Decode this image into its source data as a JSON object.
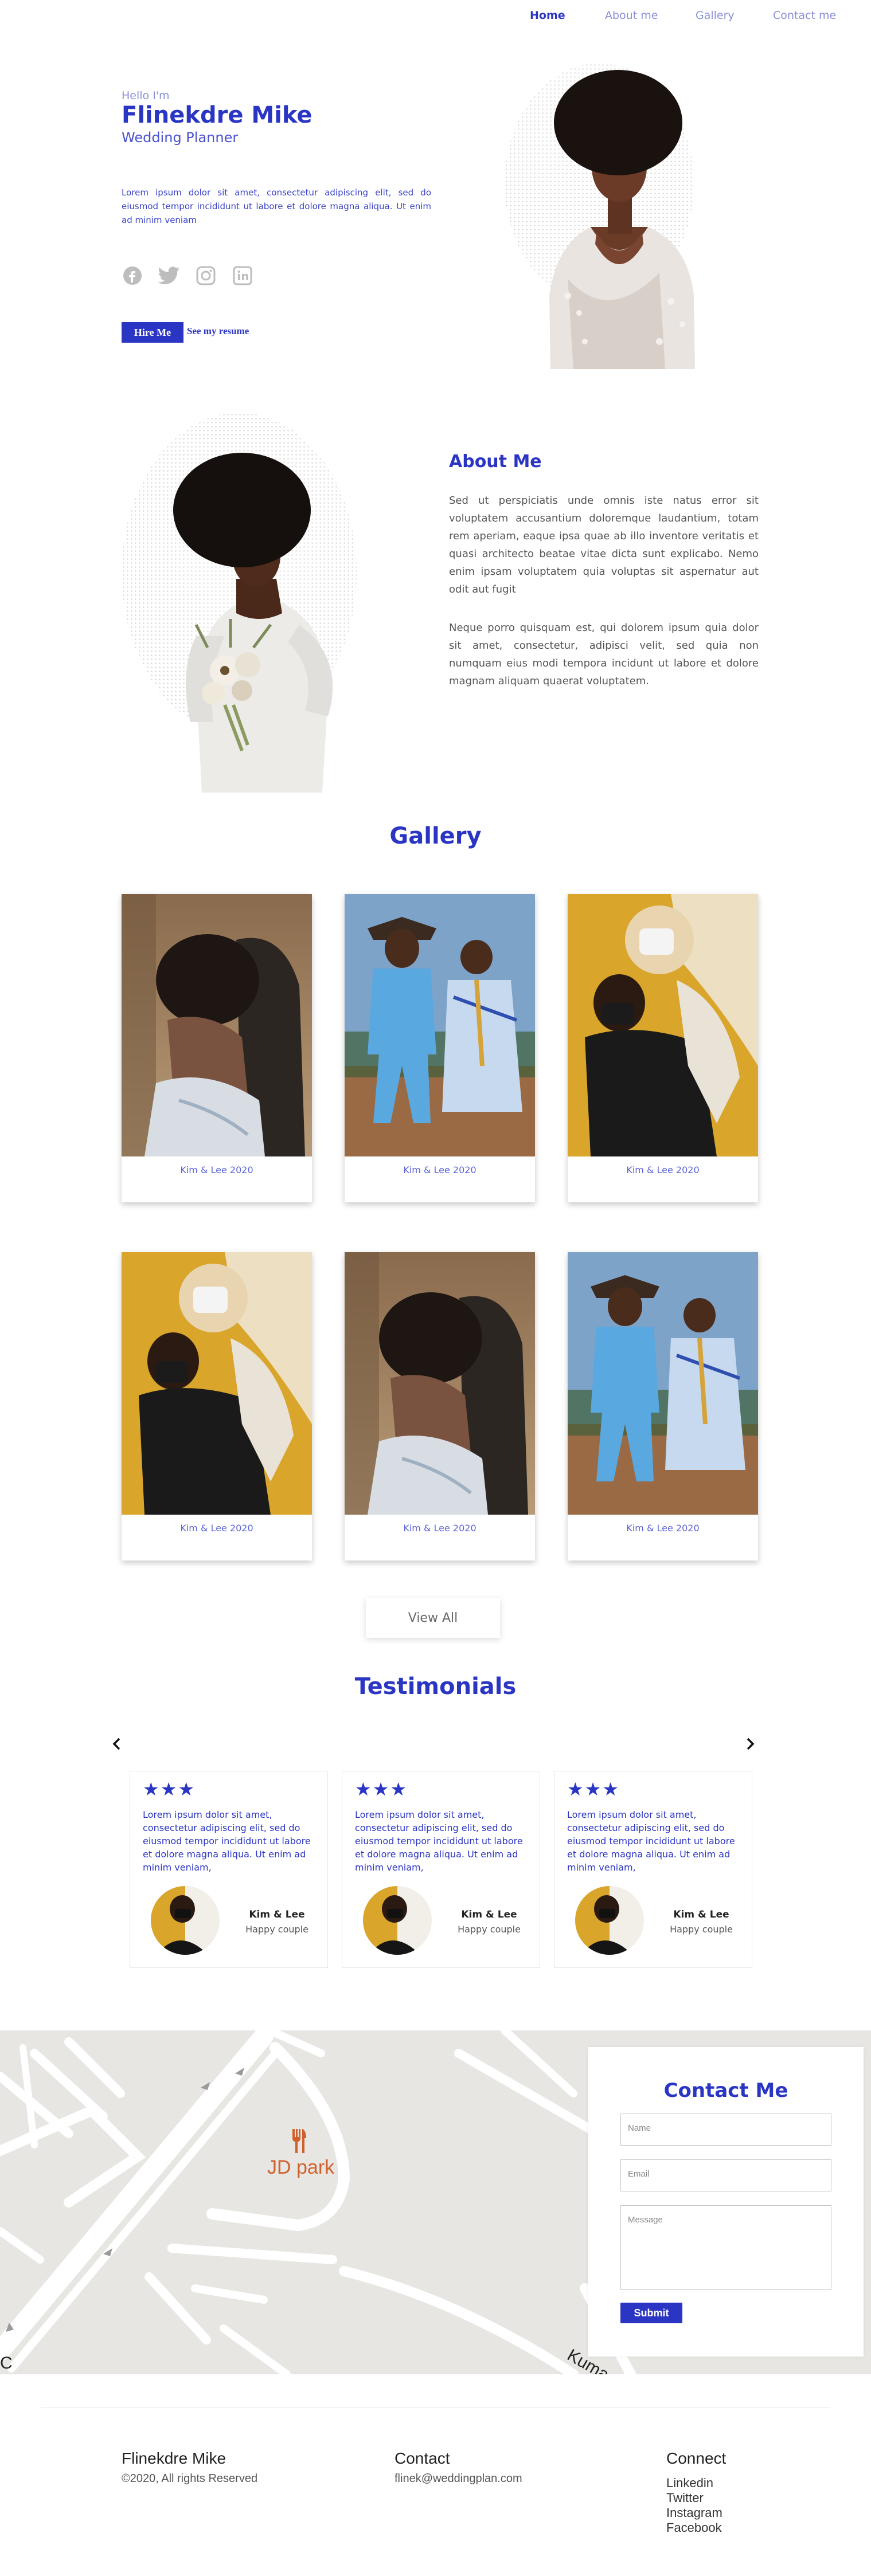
{
  "nav": {
    "items": [
      "Home",
      "About me",
      "Gallery",
      "Contact me"
    ],
    "active": "Home"
  },
  "hero": {
    "greeting": "Hello I'm",
    "name": "Flinekdre Mike",
    "role": "Wedding Planner",
    "description": "Lorem ipsum dolor sit amet, consectetur adipiscing elit, sed do eiusmod tempor incididunt ut labore et dolore magna aliqua. Ut enim ad minim veniam",
    "social_icons": [
      "facebook-icon",
      "twitter-icon",
      "instagram-icon",
      "linkedin-icon"
    ],
    "hire_label": "Hire Me",
    "resume_label": "See my resume"
  },
  "about": {
    "title": "About Me",
    "p1": "Sed ut perspiciatis unde omnis iste natus error sit voluptatem accusantium doloremque laudantium, totam rem aperiam, eaque ipsa quae ab illo inventore veritatis et quasi architecto beatae vitae dicta sunt explicabo. Nemo enim ipsam voluptatem quia voluptas sit aspernatur aut odit aut fugit",
    "p2": "Neque porro quisquam est, qui dolorem ipsum quia dolor sit amet, consectetur, adipisci velit, sed quia non numquam eius modi tempora incidunt ut labore et dolore magnam aliquam quaerat voluptatem."
  },
  "gallery": {
    "title": "Gallery",
    "items": [
      {
        "caption": "Kim & Lee 2020"
      },
      {
        "caption": "Kim & Lee 2020"
      },
      {
        "caption": "Kim & Lee 2020"
      },
      {
        "caption": "Kim & Lee 2020"
      },
      {
        "caption": "Kim & Lee 2020"
      },
      {
        "caption": "Kim & Lee 2020"
      }
    ],
    "view_all_label": "View All"
  },
  "testimonials": {
    "title": "Testimonials",
    "items": [
      {
        "stars": "★★★",
        "text": "Lorem ipsum dolor sit amet, consectetur adipiscing elit, sed do eiusmod tempor incididunt ut labore et dolore magna aliqua. Ut enim ad minim veniam,",
        "name": "Kim & Lee",
        "role": "Happy couple"
      },
      {
        "stars": "★★★",
        "text": "Lorem ipsum dolor sit amet, consectetur adipiscing elit, sed do eiusmod tempor incididunt ut labore et dolore magna aliqua. Ut enim ad minim veniam,",
        "name": "Kim & Lee",
        "role": "Happy couple"
      },
      {
        "stars": "★★★",
        "text": "Lorem ipsum dolor sit amet, consectetur adipiscing elit, sed do eiusmod tempor incididunt ut labore et dolore magna aliqua. Ut enim ad minim veniam,",
        "name": "Kim & Lee",
        "role": "Happy couple"
      }
    ]
  },
  "map": {
    "place_label": "JD park",
    "road_label": "Kuma"
  },
  "contact": {
    "title": "Contact Me",
    "name_placeholder": "Name",
    "email_placeholder": "Email",
    "message_placeholder": "Message",
    "submit_label": "Submit"
  },
  "footer": {
    "brand": "Flinekdre Mike",
    "copyright": "©2020, All rights Reserved",
    "contact_title": "Contact",
    "email": "flinek@weddingplan.com",
    "connect_title": "Connect",
    "links": [
      "Linkedin",
      "Twitter",
      "Instagram",
      "Facebook"
    ]
  },
  "colors": {
    "accent": "#2b35c4",
    "accent_light": "#8a8fd6",
    "mustard": "#d9a52a"
  }
}
